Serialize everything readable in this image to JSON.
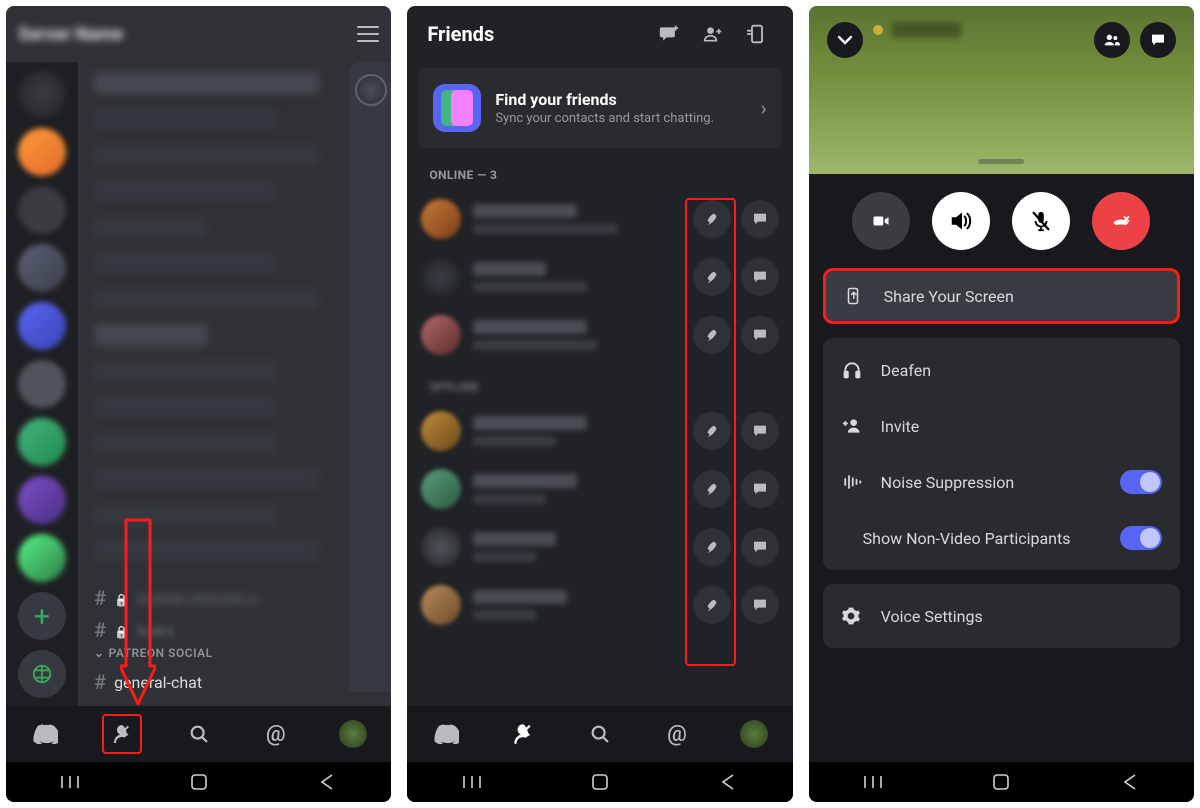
{
  "screen1": {
    "server_title": "Server Name",
    "category_social": "PATREON SOCIAL",
    "general_chat": "general-chat",
    "locked1": "locked channel a",
    "locked2": "leaks"
  },
  "screen2": {
    "header": "Friends",
    "sync_heading": "Find your friends",
    "sync_sub": "Sync your contacts and start chatting.",
    "online_label": "ONLINE — 3",
    "offline_label": "OFFLINE"
  },
  "screen3": {
    "share_screen": "Share Your Screen",
    "deafen": "Deafen",
    "invite": "Invite",
    "noise": "Noise Suppression",
    "show_nonvideo": "Show Non-Video Participants",
    "voice_settings": "Voice Settings"
  }
}
